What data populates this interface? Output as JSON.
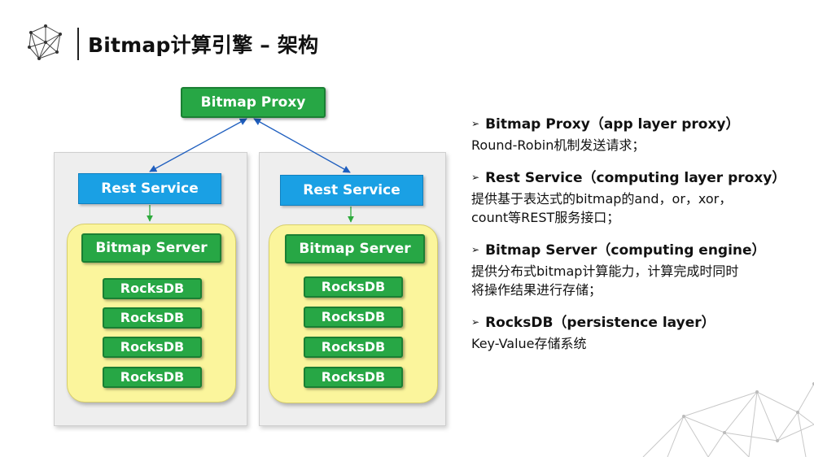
{
  "slide": {
    "title": "Bitmap计算引擎 – 架构"
  },
  "diagram": {
    "proxy": "Bitmap Proxy",
    "clusters": [
      {
        "service": "Rest Service",
        "server": "Bitmap Server",
        "dbs": [
          "RocksDB",
          "RocksDB",
          "RocksDB",
          "RocksDB"
        ]
      },
      {
        "service": "Rest Service",
        "server": "Bitmap Server",
        "dbs": [
          "RocksDB",
          "RocksDB",
          "RocksDB",
          "RocksDB"
        ]
      }
    ]
  },
  "descriptions": [
    {
      "heading": "Bitmap Proxy（app layer proxy）",
      "lines": [
        "Round-Robin机制发送请求；"
      ]
    },
    {
      "heading": "Rest Service（computing layer proxy）",
      "lines": [
        "提供基于表达式的bitmap的and，or，xor，",
        "count等REST服务接口；"
      ]
    },
    {
      "heading": "Bitmap Server（computing engine）",
      "lines": [
        "提供分布式bitmap计算能力，计算完成时同时",
        "将操作结果进行存储；"
      ]
    },
    {
      "heading": "RocksDB（persistence layer）",
      "lines": [
        "Key-Value存储系统"
      ]
    }
  ],
  "colors": {
    "service_blue": "#1aa0e4",
    "node_green": "#27a745",
    "cluster_yellow": "#fbf59c",
    "arrow_blue": "#1f5fbf",
    "arrow_green": "#2eaa3c"
  },
  "icons": {
    "bullet": "triangle-bullet-icon",
    "logo": "polygon-network-logo-icon"
  }
}
